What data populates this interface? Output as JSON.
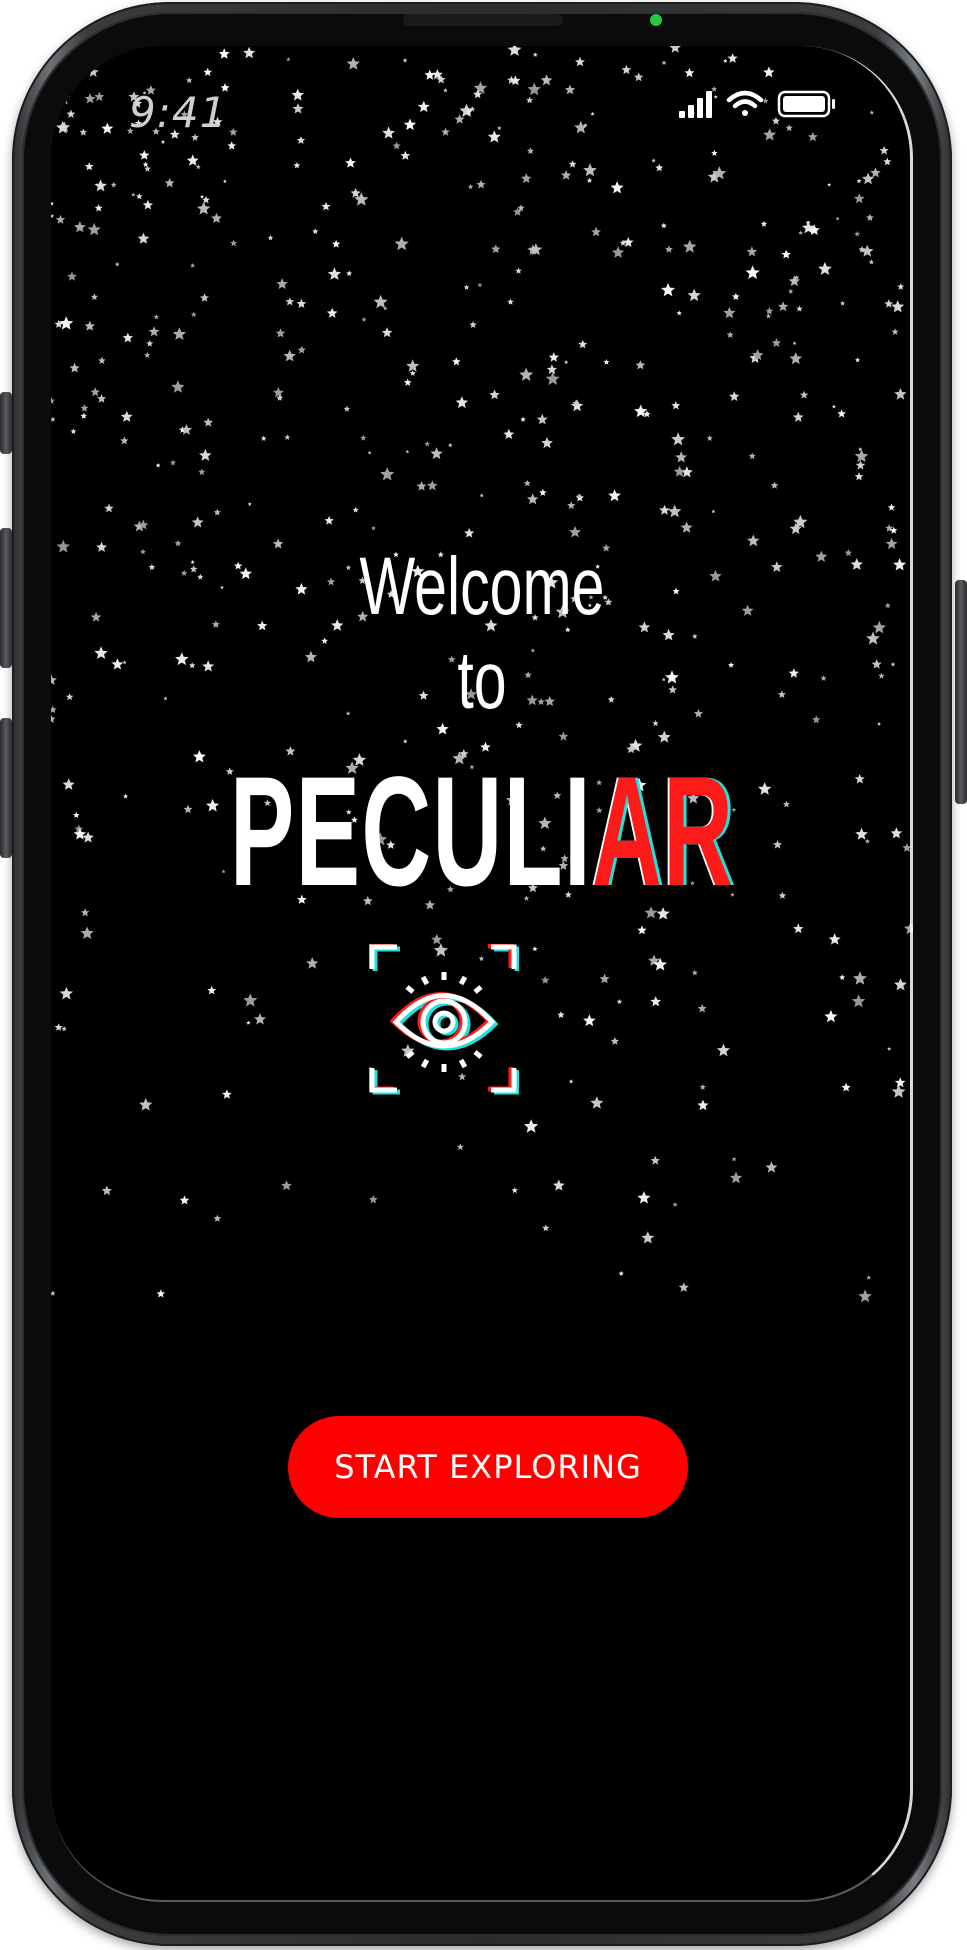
{
  "status_bar": {
    "time": "9:41",
    "signal_icon": "cellular-signal-icon",
    "wifi_icon": "wifi-icon",
    "battery_icon": "battery-icon"
  },
  "hero": {
    "welcome_line1": "Welcome",
    "welcome_line2": "to",
    "brand_main": "PECULI",
    "brand_accent": "AR",
    "icon": "eye-scan-icon"
  },
  "cta": {
    "label": "START EXPLORING"
  },
  "colors": {
    "background": "#000000",
    "accent": "#ff0000",
    "glitch_cyan": "#1de3e0",
    "text": "#ffffff"
  }
}
